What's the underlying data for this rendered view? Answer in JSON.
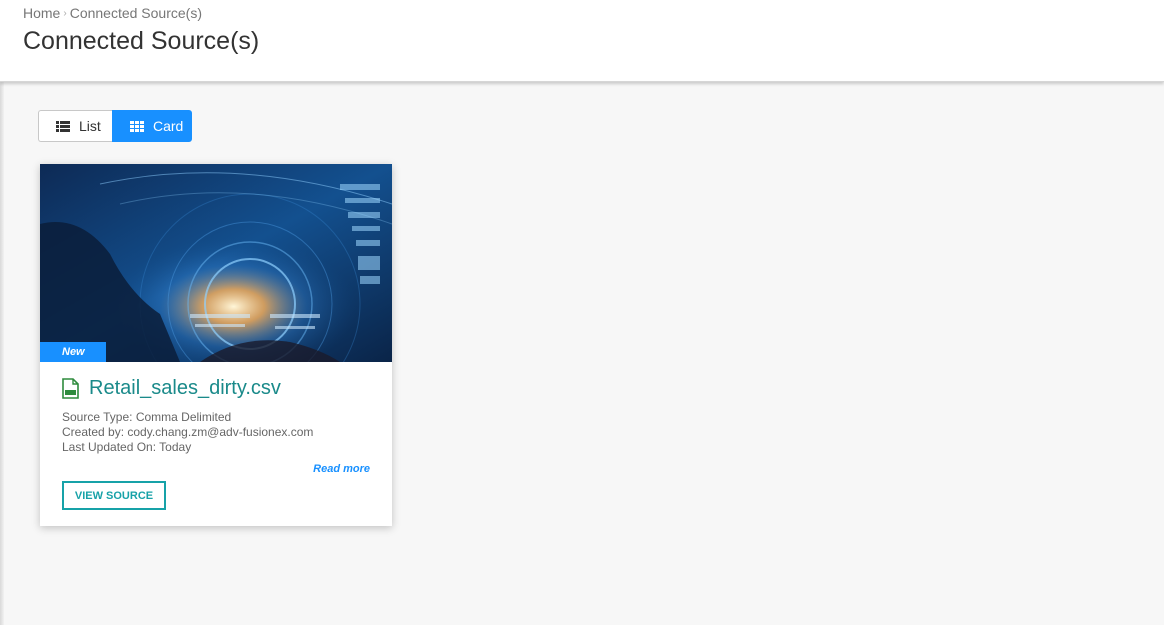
{
  "breadcrumb": {
    "home": "Home",
    "separator": "›",
    "current": "Connected Source(s)"
  },
  "page": {
    "title": "Connected Source(s)"
  },
  "view_toggle": {
    "list_label": "List",
    "card_label": "Card",
    "active": "Card",
    "list_icon": "list-icon",
    "card_icon": "grid-icon"
  },
  "sources": [
    {
      "badge": "New",
      "icon": "csv-file-icon",
      "name": "Retail_sales_dirty.csv",
      "source_type": "Source Type: Comma Delimited",
      "created_by": "Created by: cody.chang.zm@adv-fusionex.com",
      "last_updated": "Last Updated On: Today",
      "read_more": "Read more",
      "view_button": "VIEW SOURCE"
    }
  ],
  "colors": {
    "accent": "#1890ff",
    "teal": "#17a2a8",
    "title_teal": "#1a8a8a"
  }
}
